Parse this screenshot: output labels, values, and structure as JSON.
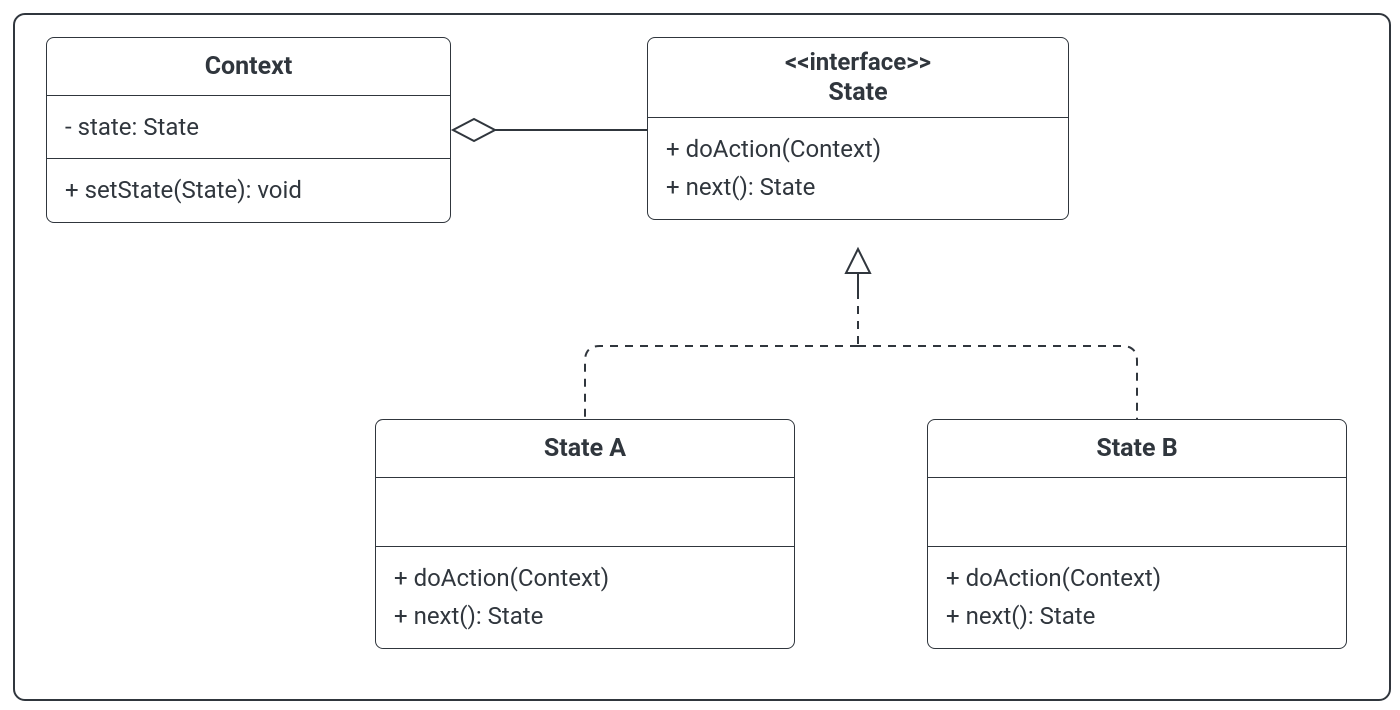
{
  "classes": {
    "context": {
      "name": "Context",
      "attributes": [
        "- state: State"
      ],
      "operations": [
        "+ setState(State): void"
      ]
    },
    "state": {
      "stereotype": "<<interface>>",
      "name": "State",
      "operations": [
        "+ doAction(Context)",
        "+ next(): State"
      ]
    },
    "stateA": {
      "name": "State A",
      "operations": [
        "+ doAction(Context)",
        "+ next(): State"
      ]
    },
    "stateB": {
      "name": "State B",
      "operations": [
        "+ doAction(Context)",
        "+ next(): State"
      ]
    }
  },
  "relationships": [
    {
      "kind": "aggregation",
      "from": "state",
      "to": "context"
    },
    {
      "kind": "realization",
      "from": "stateA",
      "to": "state"
    },
    {
      "kind": "realization",
      "from": "stateB",
      "to": "state"
    }
  ]
}
